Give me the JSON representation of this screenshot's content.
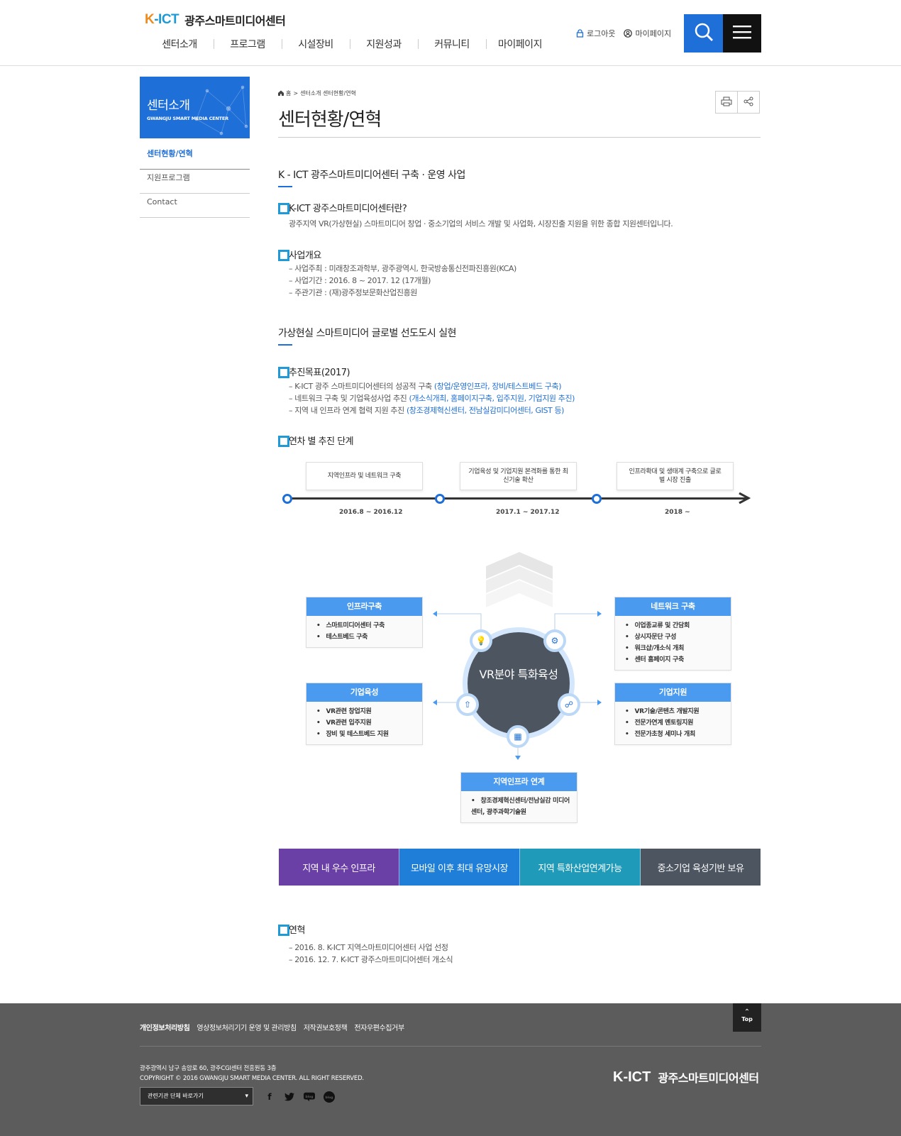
{
  "header": {
    "logo_kict_k": "K",
    "logo_kict_rest": "-ICT",
    "logo_name": "광주스마트미디어센터",
    "gnb": [
      "센터소개",
      "프로그램",
      "시설장비",
      "지원성과",
      "커뮤니티",
      "마이페이지"
    ],
    "util": {
      "logout": "로그아웃",
      "mypage": "마이페이지"
    }
  },
  "side": {
    "title": "센터소개",
    "subtitle": "GWANGJU SMART MEDIA CENTER",
    "menu": [
      "센터현황/연혁",
      "지원프로그램",
      "Contact"
    ]
  },
  "content": {
    "breadcrumb_home": "홈",
    "breadcrumb_path": "센터소개 센터현황/연혁",
    "title": "센터현황/연혁",
    "sec1": {
      "title": "K - ICT 광주스마트미디어센터 구축 · 운영 사업",
      "q_title": "K-ICT 광주스마트미디어센터란?",
      "q_text": "광주지역 VR(가상현실) 스마트미디어 창업 · 중소기업의 서비스 개발 및 사업화, 시장진출 지원을 위한 종합 지원센터입니다.",
      "overview_title": "사업개요",
      "overview": [
        "사업주최 : 미래창조과학부, 광주광역시, 한국방송통신전파진흥원(KCA)",
        "사업기간 : 2016. 8 ~ 2017. 12 (17개월)",
        "주관기관 : (재)광주정보문화산업진흥원"
      ]
    },
    "sec2": {
      "title": "가상현실 스마트미디어 글로벌 선도도시 실현",
      "goal_title": "추진목표(2017)",
      "goals": [
        {
          "text": "K-ICT 광주 스마트미디어센터의 성공적 구축 ",
          "hl": "(창업/운영인프라, 장비/테스트베드 구축)"
        },
        {
          "text": "네트워크 구축 및 기업육성사업 추진 ",
          "hl": "(개소식개최, 홈페이지구축, 입주지원, 기업지원 추진)"
        },
        {
          "text": "지역 내 인프라 연계 협력 지원 추진 ",
          "hl": "(창조경제혁신센터, 전남실감미디어센터, GIST 등)"
        }
      ],
      "stage_title": "연차 별 추진 단계",
      "stages": [
        {
          "label": "지역인프라 및 네트워크 구축",
          "date": "2016.8 ~ 2016.12"
        },
        {
          "label": "기업육성 및 기업지원 본격화를 통한 최신기술 확산",
          "date": "2017.1 ~ 2017.12"
        },
        {
          "label": "인프라확대 및 생태계 구축으로 글로벌 시장 진출",
          "date": "2018 ~"
        }
      ]
    },
    "diagram": {
      "center": "VR분야 특화육성",
      "infra": {
        "title": "인프라구축",
        "items": [
          "스마트미디어센터 구축",
          "테스트베드 구축"
        ]
      },
      "network": {
        "title": "네트워크 구축",
        "items": [
          "이업종교류 및 간담회",
          "상시자문단 구성",
          "워크샵/개소식 개최",
          "센터 홈페이지 구축"
        ]
      },
      "growth": {
        "title": "기업육성",
        "items": [
          "VR관련 창업지원",
          "VR관련 입주지원",
          "장비 및 테스트베드 지원"
        ]
      },
      "support": {
        "title": "기업지원",
        "items": [
          "VR기술/콘텐츠 개발지원",
          "전문가연계 멘토링지원",
          "전문가초청 세미나 개최"
        ]
      },
      "region": {
        "title": "지역인프라 연계",
        "items": [
          "창조경제혁신센터/전남실감 미디어센터, 광주과학기술원"
        ]
      }
    },
    "band": [
      {
        "label": "지역 내 우수 인프라",
        "color": "#6a3fa6"
      },
      {
        "label": "모바일 이후 최대 유망시장",
        "color": "#1f7fd8"
      },
      {
        "label": "지역 특화산업연계가능",
        "color": "#1f9ab8"
      },
      {
        "label": "중소기업 육성기반 보유",
        "color": "#4d5561"
      }
    ],
    "history_title": "연혁",
    "history": [
      "2016. 8. K-ICT 지역스마트미디어센터 사업 선정",
      "2016. 12. 7. K-ICT 광주스마트미디어센터 개소식"
    ]
  },
  "footer": {
    "links": [
      "개인정보처리방침",
      "영상정보처리기기 운영 및 관리방침",
      "저작권보호정책",
      "전자우편수집거부"
    ],
    "address": "광주광역시 남구 송암로 60, 광주CGI센터 전흥원동 3층",
    "copyright": "COPYRIGHT © 2016 GWANGJU SMART MEDIA CENTER. ALL RIGHT RESERVED.",
    "select_label": "관련기관 단체 바로가기",
    "top": "Top",
    "sns": [
      "f",
      "t",
      "blog",
      "blog"
    ]
  }
}
